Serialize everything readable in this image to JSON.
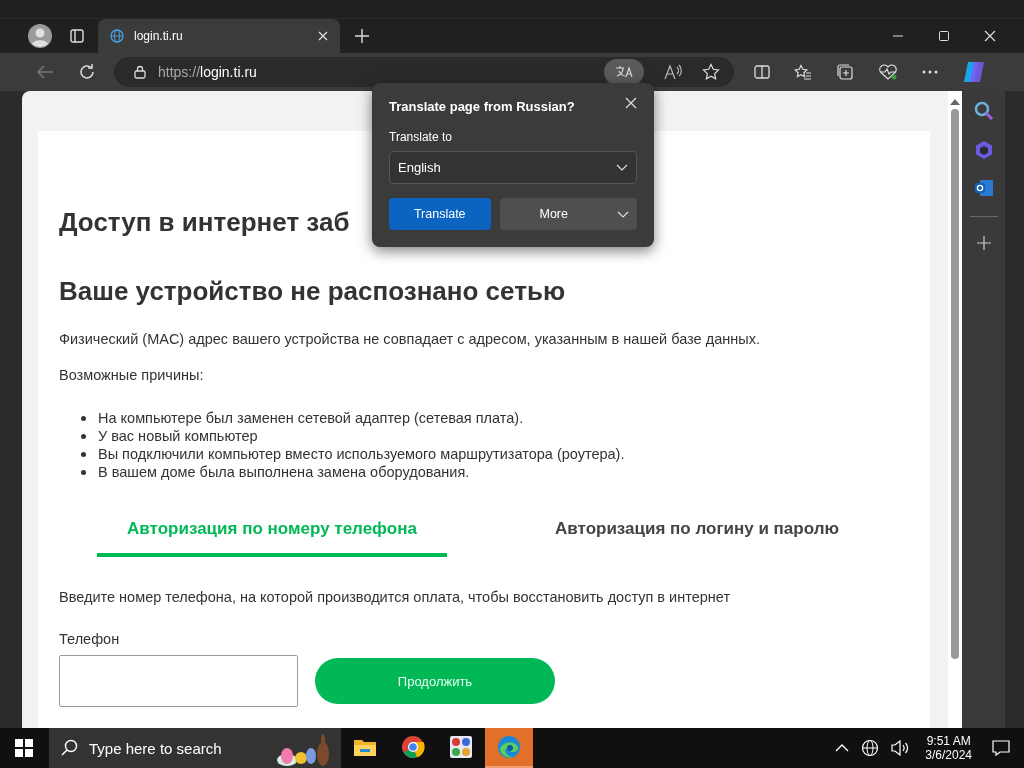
{
  "browser": {
    "tab_title": "login.ti.ru",
    "url_scheme": "https://",
    "url_host": "login.ti.ru"
  },
  "translate_popup": {
    "title": "Translate page from Russian?",
    "label": "Translate to",
    "language": "English",
    "translate_button": "Translate",
    "more_button": "More"
  },
  "page": {
    "heading": "Доступ в интернет заб",
    "subheading": "Ваше устройство не распознано сетью",
    "paragraph": "Физический (MAC) адрес вашего устройства не совпадает с адресом, указанным в нашей базе данных.",
    "reasons_label": "Возможные причины:",
    "reasons": [
      "На компьютере был заменен сетевой адаптер (сетевая плата).",
      "У вас новый компьютер",
      "Вы подключили компьютер вместо используемого маршрутизатора (роутера).",
      "В вашем доме была выполнена замена оборудования."
    ],
    "auth_tabs": [
      {
        "label": "Авторизация по номеру телефона",
        "selected": true
      },
      {
        "label": "Авторизация по логину и паролю",
        "selected": false
      }
    ],
    "instruction": "Введите номер телефона, на которой производится оплата, чтобы восстановить доступ в интернет",
    "phone_label": "Телефон",
    "continue_button": "Продолжить"
  },
  "taskbar": {
    "search_placeholder": "Type here to search",
    "apps": [
      {
        "kind": "folder",
        "selected": false
      },
      {
        "kind": "chrome",
        "selected": false
      },
      {
        "kind": "tiles",
        "selected": false
      },
      {
        "kind": "edge",
        "selected": true
      }
    ],
    "time": "9:51 AM",
    "date": "3/6/2024"
  }
}
